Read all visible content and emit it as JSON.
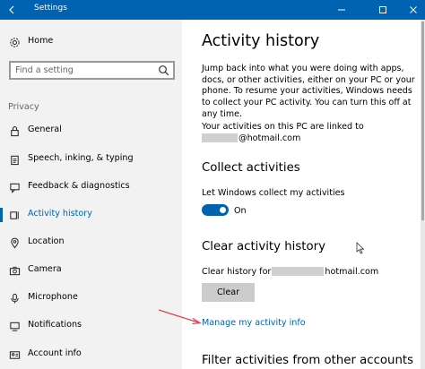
{
  "window": {
    "title": "Settings",
    "colors": {
      "accent": "#0063b1",
      "titlebar_text": "#ffffff"
    },
    "icons": [
      "back-arrow-icon",
      "minimize-icon",
      "maximize-icon",
      "close-icon"
    ]
  },
  "sidebar": {
    "home_label": "Home",
    "search": {
      "placeholder": "Find a setting",
      "value": ""
    },
    "section": "Privacy",
    "items": [
      {
        "label": "General",
        "icon": "lock-icon",
        "active": false
      },
      {
        "label": "Speech, inking, & typing",
        "icon": "clipboard-icon",
        "active": false
      },
      {
        "label": "Feedback & diagnostics",
        "icon": "feedback-icon",
        "active": false
      },
      {
        "label": "Activity history",
        "icon": "activity-history-icon",
        "active": true
      },
      {
        "label": "Location",
        "icon": "location-icon",
        "active": false
      },
      {
        "label": "Camera",
        "icon": "camera-icon",
        "active": false
      },
      {
        "label": "Microphone",
        "icon": "microphone-icon",
        "active": false
      },
      {
        "label": "Notifications",
        "icon": "notifications-icon",
        "active": false
      },
      {
        "label": "Account info",
        "icon": "account-info-icon",
        "active": false
      }
    ]
  },
  "main": {
    "title": "Activity history",
    "description": "Jump back into what you were doing with apps, docs, or other activities, either on your PC or your phone. To resume your activities, Windows needs to collect your PC activity. You can turn this off at any time.",
    "linked_text": "Your activities on this PC are linked to",
    "linked_account": "@hotmail.com",
    "collect": {
      "heading": "Collect activities",
      "toggle_label": "Let Windows collect my activities",
      "toggle_state": "On",
      "toggle_on": true
    },
    "clear": {
      "heading": "Clear activity history",
      "text": "Clear history for",
      "account": "hotmail.com",
      "button_label": "Clear"
    },
    "manage_link": "Manage my activity info",
    "filter_heading": "Filter activities from other accounts"
  }
}
